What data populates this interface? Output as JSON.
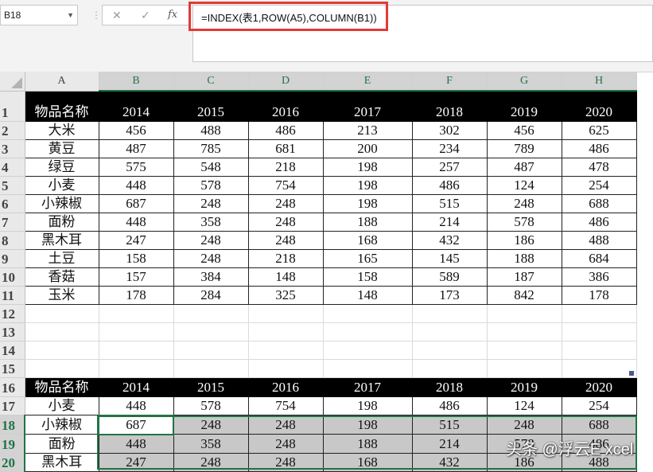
{
  "namebox": {
    "value": "B18"
  },
  "formula_bar": {
    "cancel_symbol": "✕",
    "enter_symbol": "✓",
    "fx_label": "fx",
    "formula": "=INDEX(表1,ROW(A5),COLUMN(B1))",
    "highlight_color": "#e53935"
  },
  "sheet": {
    "columns": [
      "A",
      "B",
      "C",
      "D",
      "E",
      "F",
      "G",
      "H"
    ],
    "selected_columns": [
      "B",
      "C",
      "D",
      "E",
      "F",
      "G",
      "H"
    ],
    "rows": [
      {
        "n": "1",
        "kind": "hdr",
        "cells": [
          "物品名称",
          "2014",
          "2015",
          "2016",
          "2017",
          "2018",
          "2019",
          "2020"
        ]
      },
      {
        "n": "2",
        "kind": "data",
        "cells": [
          "大米",
          "456",
          "488",
          "486",
          "213",
          "302",
          "456",
          "625"
        ]
      },
      {
        "n": "3",
        "kind": "data",
        "cells": [
          "黄豆",
          "487",
          "785",
          "681",
          "200",
          "234",
          "789",
          "486"
        ]
      },
      {
        "n": "4",
        "kind": "data",
        "cells": [
          "绿豆",
          "575",
          "548",
          "218",
          "198",
          "257",
          "487",
          "478"
        ]
      },
      {
        "n": "5",
        "kind": "data",
        "cells": [
          "小麦",
          "448",
          "578",
          "754",
          "198",
          "486",
          "124",
          "254"
        ]
      },
      {
        "n": "6",
        "kind": "data",
        "cells": [
          "小辣椒",
          "687",
          "248",
          "248",
          "198",
          "515",
          "248",
          "688"
        ]
      },
      {
        "n": "7",
        "kind": "data",
        "cells": [
          "面粉",
          "448",
          "358",
          "248",
          "188",
          "214",
          "578",
          "486"
        ]
      },
      {
        "n": "8",
        "kind": "data",
        "cells": [
          "黑木耳",
          "247",
          "248",
          "248",
          "168",
          "432",
          "186",
          "488"
        ]
      },
      {
        "n": "9",
        "kind": "data",
        "cells": [
          "土豆",
          "158",
          "248",
          "218",
          "165",
          "145",
          "188",
          "684"
        ]
      },
      {
        "n": "10",
        "kind": "data",
        "cells": [
          "香菇",
          "157",
          "384",
          "148",
          "158",
          "589",
          "187",
          "386"
        ]
      },
      {
        "n": "11",
        "kind": "data",
        "cells": [
          "玉米",
          "178",
          "284",
          "325",
          "148",
          "173",
          "842",
          "178"
        ]
      },
      {
        "n": "12",
        "kind": "empty",
        "cells": [
          "",
          "",
          "",
          "",
          "",
          "",
          "",
          ""
        ]
      },
      {
        "n": "13",
        "kind": "empty",
        "cells": [
          "",
          "",
          "",
          "",
          "",
          "",
          "",
          ""
        ]
      },
      {
        "n": "14",
        "kind": "empty",
        "cells": [
          "",
          "",
          "",
          "",
          "",
          "",
          "",
          ""
        ]
      },
      {
        "n": "15",
        "kind": "empty",
        "cells": [
          "",
          "",
          "",
          "",
          "",
          "",
          "",
          ""
        ]
      },
      {
        "n": "16",
        "kind": "hdr",
        "cells": [
          "物品名称",
          "2014",
          "2015",
          "2016",
          "2017",
          "2018",
          "2019",
          "2020"
        ]
      },
      {
        "n": "17",
        "kind": "data",
        "cells": [
          "小麦",
          "448",
          "578",
          "754",
          "198",
          "486",
          "124",
          "254"
        ]
      },
      {
        "n": "18",
        "kind": "selr",
        "cells": [
          "小辣椒",
          "687",
          "248",
          "248",
          "198",
          "515",
          "248",
          "688"
        ]
      },
      {
        "n": "19",
        "kind": "selr",
        "cells": [
          "面粉",
          "448",
          "358",
          "248",
          "188",
          "214",
          "578",
          "486"
        ]
      },
      {
        "n": "20",
        "kind": "selr",
        "cells": [
          "黑木耳",
          "247",
          "248",
          "248",
          "168",
          "432",
          "186",
          "488"
        ]
      }
    ],
    "selected_rows": [
      "18",
      "19",
      "20"
    ],
    "active_cell": "B18",
    "accent_color": "#217346"
  },
  "watermark": {
    "text": "头条 @浮云E xcel"
  }
}
